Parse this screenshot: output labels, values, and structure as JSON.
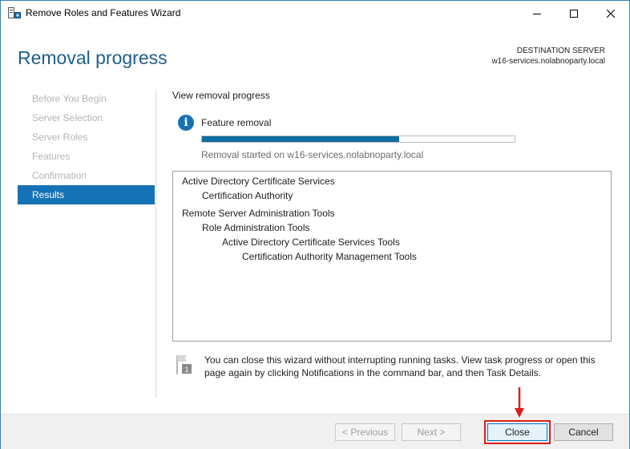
{
  "window": {
    "title": "Remove Roles and Features Wizard",
    "icons": {
      "app": "server-manager-icon",
      "minimize": "minimize-icon",
      "maximize": "maximize-icon",
      "close": "close-icon"
    }
  },
  "header": {
    "page_title": "Removal progress",
    "destination_label": "DESTINATION SERVER",
    "destination_server": "w16-services.nolabnoparty.local"
  },
  "nav": {
    "items": [
      {
        "label": "Before You Begin",
        "active": false
      },
      {
        "label": "Server Selection",
        "active": false
      },
      {
        "label": "Server Roles",
        "active": false
      },
      {
        "label": "Features",
        "active": false
      },
      {
        "label": "Confirmation",
        "active": false
      },
      {
        "label": "Results",
        "active": true
      }
    ]
  },
  "content": {
    "section_label": "View removal progress",
    "feature_label": "Feature removal",
    "progress_percent": 63,
    "status_text": "Removal started on w16-services.nolabnoparty.local",
    "results": [
      {
        "text": "Active Directory Certificate Services",
        "level": 0
      },
      {
        "text": "Certification Authority",
        "level": 1
      },
      {
        "text": "Remote Server Administration Tools",
        "level": 0
      },
      {
        "text": "Role Administration Tools",
        "level": 1
      },
      {
        "text": "Active Directory Certificate Services Tools",
        "level": 2
      },
      {
        "text": "Certification Authority Management Tools",
        "level": 3
      }
    ],
    "note_icon_number": "1",
    "note_text": "You can close this wizard without interrupting running tasks. View task progress or open this page again by clicking Notifications in the command bar, and then Task Details."
  },
  "footer": {
    "previous_label": "< Previous",
    "next_label": "Next >",
    "close_label": "Close",
    "cancel_label": "Cancel"
  },
  "colors": {
    "accent": "#1672b6",
    "title": "#1e5f8c",
    "progress": "#0f6ea0",
    "annotation": "#e01b1b"
  }
}
